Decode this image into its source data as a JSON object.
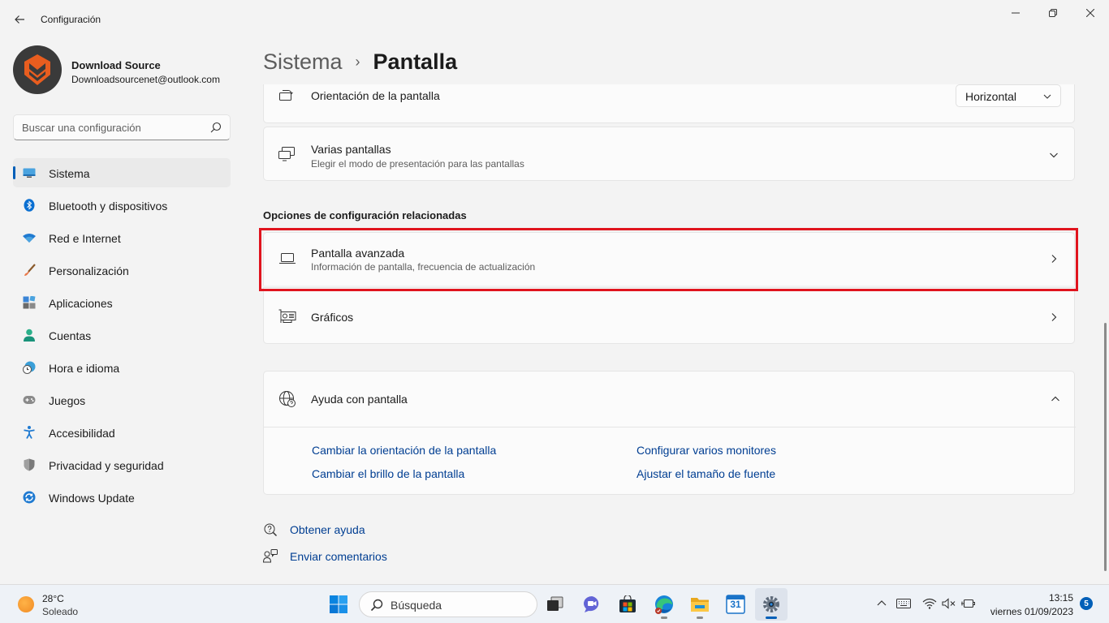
{
  "window": {
    "title": "Configuración",
    "controls": {
      "minimize": "–",
      "maximize": "□",
      "close": "✕"
    }
  },
  "profile": {
    "name": "Download Source",
    "email": "Downloadsourcenet@outlook.com"
  },
  "search": {
    "placeholder": "Buscar una configuración"
  },
  "sidebar": {
    "items": [
      {
        "label": "Sistema",
        "icon": "monitor-icon",
        "active": true
      },
      {
        "label": "Bluetooth y dispositivos",
        "icon": "bluetooth-icon"
      },
      {
        "label": "Red e Internet",
        "icon": "wifi-icon"
      },
      {
        "label": "Personalización",
        "icon": "brush-icon"
      },
      {
        "label": "Aplicaciones",
        "icon": "apps-icon"
      },
      {
        "label": "Cuentas",
        "icon": "person-icon"
      },
      {
        "label": "Hora e idioma",
        "icon": "clock-globe-icon"
      },
      {
        "label": "Juegos",
        "icon": "gamepad-icon"
      },
      {
        "label": "Accesibilidad",
        "icon": "accessibility-icon"
      },
      {
        "label": "Privacidad y seguridad",
        "icon": "shield-icon"
      },
      {
        "label": "Windows Update",
        "icon": "update-icon"
      }
    ]
  },
  "breadcrumb": {
    "parent": "Sistema",
    "separator": "›",
    "current": "Pantalla"
  },
  "main": {
    "orientation": {
      "title": "Orientación de la pantalla",
      "value": "Horizontal"
    },
    "multiple_displays": {
      "title": "Varias pantallas",
      "subtitle": "Elegir el modo de presentación para las pantallas"
    },
    "related_title": "Opciones de configuración relacionadas",
    "advanced_display": {
      "title": "Pantalla avanzada",
      "subtitle": "Información de pantalla, frecuencia de actualización"
    },
    "graphics": {
      "title": "Gráficos"
    },
    "help": {
      "title": "Ayuda con pantalla",
      "links": [
        "Cambiar la orientación de la pantalla",
        "Configurar varios monitores",
        "Cambiar el brillo de la pantalla",
        "Ajustar el tamaño de fuente"
      ]
    },
    "footer": {
      "get_help": "Obtener ayuda",
      "feedback": "Enviar comentarios"
    }
  },
  "taskbar": {
    "weather": {
      "temp": "28°C",
      "condition": "Soleado"
    },
    "search_label": "Búsqueda",
    "pinned": [
      "windows-start-icon",
      "task-view-icon",
      "teams-chat-icon",
      "store-icon",
      "edge-icon",
      "file-explorer-icon",
      "calendar-icon",
      "settings-icon"
    ],
    "calendar_day": "31",
    "clock": {
      "time": "13:15",
      "date": "viernes 01/09/2023"
    },
    "notification_count": "5"
  },
  "colors": {
    "accent": "#005fb8",
    "highlight_box": "#e0141e",
    "link": "#003e92"
  }
}
